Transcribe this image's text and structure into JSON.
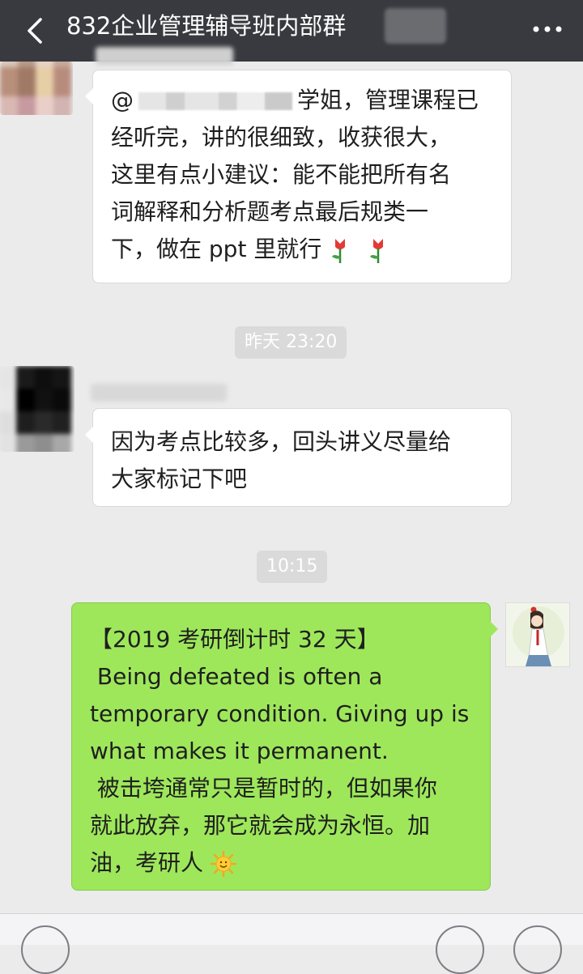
{
  "header": {
    "title": "832企业管理辅导班内部群"
  },
  "messages": [
    {
      "sender": "other",
      "mention": "@",
      "lines": [
        "学姐，管理课程已",
        "经听完，讲的很细致，收获很大，",
        "这里有点小建议：能不能把所有名",
        "词解释和分析题考点最后规类一",
        "下，做在 ppt 里就行"
      ]
    },
    {
      "time": "昨天 23:20"
    },
    {
      "sender": "other",
      "lines": [
        "因为考点比较多，回头讲义尽量给",
        "大家标记下吧"
      ]
    },
    {
      "time": "10:15"
    },
    {
      "sender": "self",
      "lines": [
        "【2019 考研倒计时 32 天】",
        " Being defeated is often a",
        "temporary condition. Giving up is",
        "what makes it permanent.",
        " 被击垮通常只是暂时的，但如果你",
        "就此放弃，那它就会成为永恒。加",
        "油，考研人"
      ]
    }
  ],
  "colors": {
    "header_bg": "#393a3f",
    "chat_bg": "#ebebeb",
    "self_bubble": "#9ee75b",
    "other_bubble": "#ffffff"
  },
  "icons": [
    "back-icon",
    "more-icon",
    "rose-emoji",
    "sun-emoji",
    "voice-icon",
    "emoji-icon",
    "plus-icon"
  ]
}
